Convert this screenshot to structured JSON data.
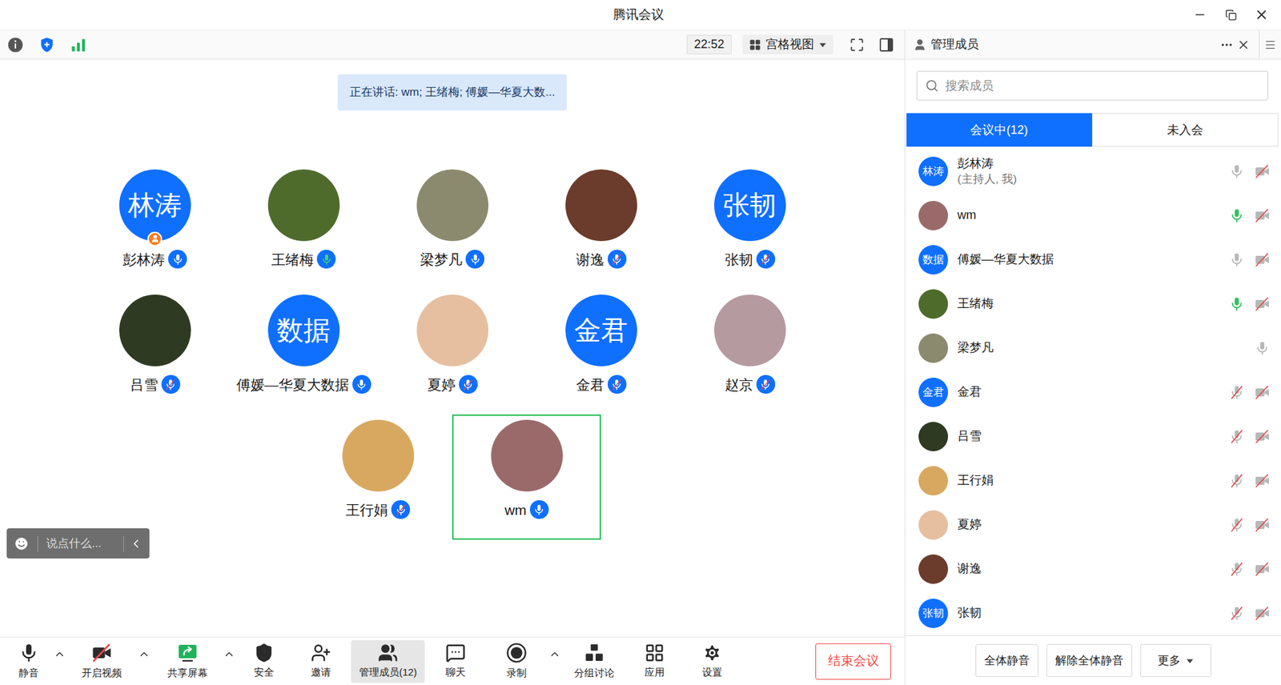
{
  "window": {
    "title": "腾讯会议"
  },
  "toolbar": {
    "time": "22:52",
    "view": "宫格视图"
  },
  "speaking_banner": "正在讲话: wm; 王绪梅; 傅媛—华夏大数...",
  "grid": [
    {
      "name": "彭林涛",
      "avatar": {
        "kind": "text",
        "text": "林涛",
        "color": "#0f6fff"
      },
      "mic": "on",
      "host": true,
      "selected": false
    },
    {
      "name": "王绪梅",
      "avatar": {
        "kind": "photo",
        "text": "",
        "color": "#4f6b2c"
      },
      "mic": "speaking",
      "host": false,
      "selected": false
    },
    {
      "name": "梁梦凡",
      "avatar": {
        "kind": "photo",
        "text": "",
        "color": "#8c8a6e"
      },
      "mic": "on",
      "host": false,
      "selected": false
    },
    {
      "name": "谢逸",
      "avatar": {
        "kind": "photo",
        "text": "",
        "color": "#6b3b2b"
      },
      "mic": "muted",
      "host": false,
      "selected": false
    },
    {
      "name": "张韧",
      "avatar": {
        "kind": "text",
        "text": "张韧",
        "color": "#0f6fff"
      },
      "mic": "muted",
      "host": false,
      "selected": false
    },
    {
      "name": "吕雪",
      "avatar": {
        "kind": "photo",
        "text": "",
        "color": "#2f3a22"
      },
      "mic": "muted",
      "host": false,
      "selected": false
    },
    {
      "name": "傅媛—华夏大数据",
      "avatar": {
        "kind": "text",
        "text": "数据",
        "color": "#0f6fff"
      },
      "mic": "on",
      "host": false,
      "selected": false
    },
    {
      "name": "夏婷",
      "avatar": {
        "kind": "photo",
        "text": "",
        "color": "#e6bfa0"
      },
      "mic": "muted",
      "host": false,
      "selected": false
    },
    {
      "name": "金君",
      "avatar": {
        "kind": "text",
        "text": "金君",
        "color": "#0f6fff"
      },
      "mic": "muted",
      "host": false,
      "selected": false
    },
    {
      "name": "赵京",
      "avatar": {
        "kind": "photo",
        "text": "",
        "color": "#b59aa0"
      },
      "mic": "muted",
      "host": false,
      "selected": false
    },
    {
      "name": "王行娟",
      "avatar": {
        "kind": "photo",
        "text": "",
        "color": "#d8a860"
      },
      "mic": "muted",
      "host": false,
      "selected": false
    },
    {
      "name": "wm",
      "avatar": {
        "kind": "photo",
        "text": "",
        "color": "#9a6a6a"
      },
      "mic": "on",
      "host": false,
      "selected": true
    }
  ],
  "chat_input": {
    "placeholder": "说点什么..."
  },
  "bottom_bar": {
    "items": [
      {
        "label": "静音",
        "kind": "mic",
        "menu": true,
        "selected": false
      },
      {
        "label": "开启视频",
        "kind": "video",
        "menu": true,
        "selected": false
      },
      {
        "label": "共享屏幕",
        "kind": "share",
        "menu": true,
        "selected": false
      },
      {
        "label": "安全",
        "kind": "security",
        "menu": false,
        "selected": false
      },
      {
        "label": "邀请",
        "kind": "invite",
        "menu": false,
        "selected": false
      },
      {
        "label": "管理成员(12)",
        "kind": "members",
        "menu": false,
        "selected": true
      },
      {
        "label": "聊天",
        "kind": "chat",
        "menu": false,
        "selected": false
      },
      {
        "label": "录制",
        "kind": "record",
        "menu": true,
        "selected": false
      },
      {
        "label": "分组讨论",
        "kind": "breakout",
        "menu": false,
        "selected": false
      },
      {
        "label": "应用",
        "kind": "apps",
        "menu": false,
        "selected": false
      },
      {
        "label": "设置",
        "kind": "settings",
        "menu": false,
        "selected": false
      }
    ],
    "end_button": "结束会议"
  },
  "members_panel": {
    "title": "管理成员",
    "search_placeholder": "搜索成员",
    "tabs": [
      {
        "label": "会议中(12)",
        "selected": true
      },
      {
        "label": "未入会",
        "selected": false
      }
    ],
    "members": [
      {
        "name": "彭林涛",
        "note": "(主持人, 我)",
        "avatar": {
          "kind": "text",
          "text": "林涛",
          "color": "#0f6fff"
        },
        "mic": "on",
        "video_icon": true
      },
      {
        "name": "wm",
        "note": "",
        "avatar": {
          "kind": "photo",
          "text": "",
          "color": "#9a6a6a"
        },
        "mic": "speaking",
        "video_icon": true
      },
      {
        "name": "傅媛—华夏大数据",
        "note": "",
        "avatar": {
          "kind": "text",
          "text": "数据",
          "color": "#0f6fff"
        },
        "mic": "on",
        "video_icon": true
      },
      {
        "name": "王绪梅",
        "note": "",
        "avatar": {
          "kind": "photo",
          "text": "",
          "color": "#4f6b2c"
        },
        "mic": "speaking",
        "video_icon": true
      },
      {
        "name": "梁梦凡",
        "note": "",
        "avatar": {
          "kind": "photo",
          "text": "",
          "color": "#8c8a6e"
        },
        "mic": "on",
        "video_icon": false
      },
      {
        "name": "金君",
        "note": "",
        "avatar": {
          "kind": "text",
          "text": "金君",
          "color": "#0f6fff"
        },
        "mic": "muted",
        "video_icon": true
      },
      {
        "name": "吕雪",
        "note": "",
        "avatar": {
          "kind": "photo",
          "text": "",
          "color": "#2f3a22"
        },
        "mic": "muted",
        "video_icon": true
      },
      {
        "name": "王行娟",
        "note": "",
        "avatar": {
          "kind": "photo",
          "text": "",
          "color": "#d8a860"
        },
        "mic": "muted",
        "video_icon": true
      },
      {
        "name": "夏婷",
        "note": "",
        "avatar": {
          "kind": "photo",
          "text": "",
          "color": "#e6bfa0"
        },
        "mic": "muted",
        "video_icon": true
      },
      {
        "name": "谢逸",
        "note": "",
        "avatar": {
          "kind": "photo",
          "text": "",
          "color": "#6b3b2b"
        },
        "mic": "muted",
        "video_icon": true
      },
      {
        "name": "张韧",
        "note": "",
        "avatar": {
          "kind": "text",
          "text": "张韧",
          "color": "#0f6fff"
        },
        "mic": "muted",
        "video_icon": true
      }
    ],
    "buttons": [
      "全体静音",
      "解除全体静音"
    ],
    "more": "更多"
  }
}
